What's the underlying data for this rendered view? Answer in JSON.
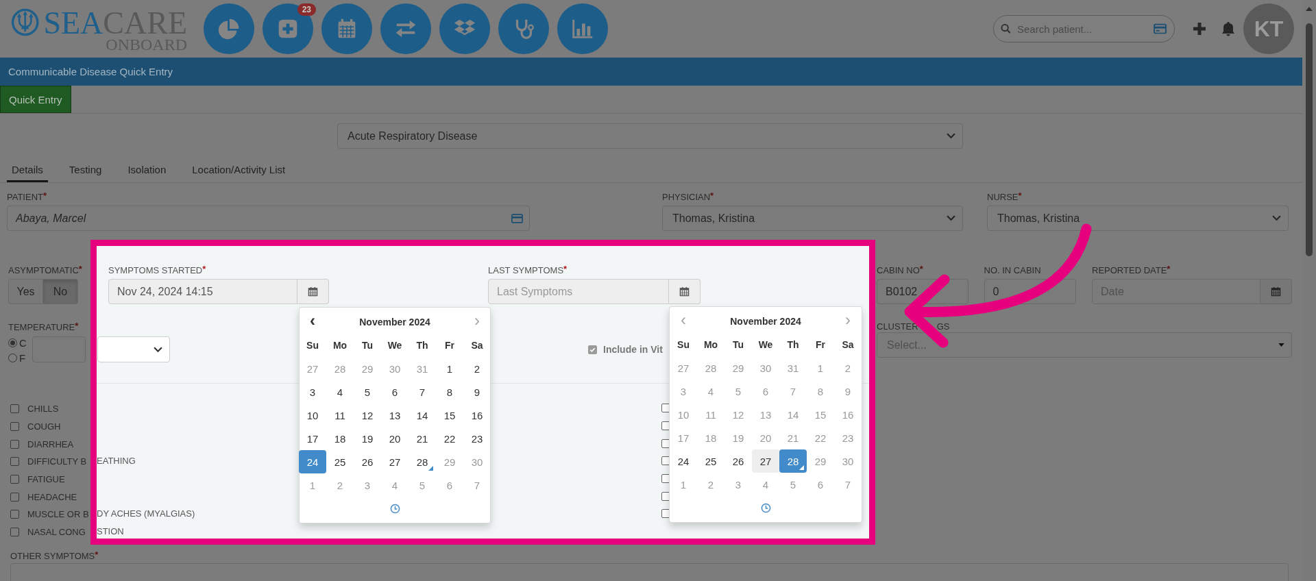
{
  "header": {
    "logo": {
      "name_a": "SEA",
      "name_b": "CARE",
      "tagline": "ONBOARD"
    },
    "nav": [
      {
        "kind": "pie"
      },
      {
        "kind": "add",
        "badge": "23"
      },
      {
        "kind": "calendar"
      },
      {
        "kind": "transfer"
      },
      {
        "kind": "dropbox"
      },
      {
        "kind": "stethoscope"
      },
      {
        "kind": "bars"
      }
    ],
    "search": {
      "placeholder": "Search patient..."
    },
    "avatar": "KT"
  },
  "title_bar": "Communicable Disease Quick Entry",
  "page_tabs": [
    {
      "label": "Quick Entry",
      "selected": true
    }
  ],
  "disease_select": {
    "value": "Acute Respiratory Disease"
  },
  "tabs": [
    {
      "label": "Details",
      "selected": true
    },
    {
      "label": "Testing",
      "selected": false
    },
    {
      "label": "Isolation",
      "selected": false
    },
    {
      "label": "Location/Activity List",
      "selected": false
    }
  ],
  "patient": {
    "label": "PATIENT",
    "required": "*",
    "value": "Abaya, Marcel"
  },
  "physician": {
    "label": "PHYSICIAN",
    "required": "*",
    "value": "Thomas, Kristina"
  },
  "nurse": {
    "label": "NURSE",
    "required": "*",
    "value": "Thomas, Kristina"
  },
  "asymptomatic": {
    "label": "ASYMPTOMATIC",
    "required": "*",
    "options": [
      {
        "label": "Yes",
        "selected": false
      },
      {
        "label": "No",
        "selected": true
      }
    ]
  },
  "temperature": {
    "label": "TEMPERATURE",
    "required": "*",
    "units": [
      {
        "label": "C",
        "selected": true
      },
      {
        "label": "F",
        "selected": false
      }
    ]
  },
  "symptoms_started": {
    "label": "SYMPTOMS STARTED",
    "required": "*",
    "value": "Nov 24, 2024 14:15"
  },
  "last_symptoms": {
    "label": "LAST SYMPTOMS",
    "required": "*",
    "placeholder": "Last Symptoms"
  },
  "include_in_vitals": {
    "label": "Include in Vit",
    "checked": true
  },
  "calendars": [
    {
      "title": "November 2024",
      "prev": {
        "label": "‹",
        "disabled": false
      },
      "next": {
        "label": "›",
        "disabled": true
      },
      "weekdays": [
        "Su",
        "Mo",
        "Tu",
        "We",
        "Th",
        "Fr",
        "Sa"
      ],
      "days": [
        {
          "label": "27",
          "muted": true,
          "selected": false,
          "today": false,
          "highlighted": false
        },
        {
          "label": "28",
          "muted": true,
          "selected": false,
          "today": false,
          "highlighted": false
        },
        {
          "label": "29",
          "muted": true,
          "selected": false,
          "today": false,
          "highlighted": false
        },
        {
          "label": "30",
          "muted": true,
          "selected": false,
          "today": false,
          "highlighted": false
        },
        {
          "label": "31",
          "muted": true,
          "selected": false,
          "today": false,
          "highlighted": false
        },
        {
          "label": "1",
          "muted": false,
          "selected": false,
          "today": false,
          "highlighted": false
        },
        {
          "label": "2",
          "muted": false,
          "selected": false,
          "today": false,
          "highlighted": false
        },
        {
          "label": "3",
          "muted": false,
          "selected": false,
          "today": false,
          "highlighted": false
        },
        {
          "label": "4",
          "muted": false,
          "selected": false,
          "today": false,
          "highlighted": false
        },
        {
          "label": "5",
          "muted": false,
          "selected": false,
          "today": false,
          "highlighted": false
        },
        {
          "label": "6",
          "muted": false,
          "selected": false,
          "today": false,
          "highlighted": false
        },
        {
          "label": "7",
          "muted": false,
          "selected": false,
          "today": false,
          "highlighted": false
        },
        {
          "label": "8",
          "muted": false,
          "selected": false,
          "today": false,
          "highlighted": false
        },
        {
          "label": "9",
          "muted": false,
          "selected": false,
          "today": false,
          "highlighted": false
        },
        {
          "label": "10",
          "muted": false,
          "selected": false,
          "today": false,
          "highlighted": false
        },
        {
          "label": "11",
          "muted": false,
          "selected": false,
          "today": false,
          "highlighted": false
        },
        {
          "label": "12",
          "muted": false,
          "selected": false,
          "today": false,
          "highlighted": false
        },
        {
          "label": "13",
          "muted": false,
          "selected": false,
          "today": false,
          "highlighted": false
        },
        {
          "label": "14",
          "muted": false,
          "selected": false,
          "today": false,
          "highlighted": false
        },
        {
          "label": "15",
          "muted": false,
          "selected": false,
          "today": false,
          "highlighted": false
        },
        {
          "label": "16",
          "muted": false,
          "selected": false,
          "today": false,
          "highlighted": false
        },
        {
          "label": "17",
          "muted": false,
          "selected": false,
          "today": false,
          "highlighted": false
        },
        {
          "label": "18",
          "muted": false,
          "selected": false,
          "today": false,
          "highlighted": false
        },
        {
          "label": "19",
          "muted": false,
          "selected": false,
          "today": false,
          "highlighted": false
        },
        {
          "label": "20",
          "muted": false,
          "selected": false,
          "today": false,
          "highlighted": false
        },
        {
          "label": "21",
          "muted": false,
          "selected": false,
          "today": false,
          "highlighted": false
        },
        {
          "label": "22",
          "muted": false,
          "selected": false,
          "today": false,
          "highlighted": false
        },
        {
          "label": "23",
          "muted": false,
          "selected": false,
          "today": false,
          "highlighted": false
        },
        {
          "label": "24",
          "muted": false,
          "selected": true,
          "today": false,
          "highlighted": false
        },
        {
          "label": "25",
          "muted": false,
          "selected": false,
          "today": false,
          "highlighted": false
        },
        {
          "label": "26",
          "muted": false,
          "selected": false,
          "today": false,
          "highlighted": false
        },
        {
          "label": "27",
          "muted": false,
          "selected": false,
          "today": false,
          "highlighted": false
        },
        {
          "label": "28",
          "muted": false,
          "selected": false,
          "today": true,
          "highlighted": false
        },
        {
          "label": "29",
          "muted": true,
          "selected": false,
          "today": false,
          "highlighted": false
        },
        {
          "label": "30",
          "muted": true,
          "selected": false,
          "today": false,
          "highlighted": false
        },
        {
          "label": "1",
          "muted": true,
          "selected": false,
          "today": false,
          "highlighted": false
        },
        {
          "label": "2",
          "muted": true,
          "selected": false,
          "today": false,
          "highlighted": false
        },
        {
          "label": "3",
          "muted": true,
          "selected": false,
          "today": false,
          "highlighted": false
        },
        {
          "label": "4",
          "muted": true,
          "selected": false,
          "today": false,
          "highlighted": false
        },
        {
          "label": "5",
          "muted": true,
          "selected": false,
          "today": false,
          "highlighted": false
        },
        {
          "label": "6",
          "muted": true,
          "selected": false,
          "today": false,
          "highlighted": false
        },
        {
          "label": "7",
          "muted": true,
          "selected": false,
          "today": false,
          "highlighted": false
        }
      ]
    },
    {
      "title": "November 2024",
      "prev": {
        "label": "‹",
        "disabled": true
      },
      "next": {
        "label": "›",
        "disabled": true
      },
      "weekdays": [
        "Su",
        "Mo",
        "Tu",
        "We",
        "Th",
        "Fr",
        "Sa"
      ],
      "days": [
        {
          "label": "27",
          "muted": true,
          "selected": false,
          "today": false,
          "highlighted": false
        },
        {
          "label": "28",
          "muted": true,
          "selected": false,
          "today": false,
          "highlighted": false
        },
        {
          "label": "29",
          "muted": true,
          "selected": false,
          "today": false,
          "highlighted": false
        },
        {
          "label": "30",
          "muted": true,
          "selected": false,
          "today": false,
          "highlighted": false
        },
        {
          "label": "31",
          "muted": true,
          "selected": false,
          "today": false,
          "highlighted": false
        },
        {
          "label": "1",
          "muted": true,
          "selected": false,
          "today": false,
          "highlighted": false
        },
        {
          "label": "2",
          "muted": true,
          "selected": false,
          "today": false,
          "highlighted": false
        },
        {
          "label": "3",
          "muted": true,
          "selected": false,
          "today": false,
          "highlighted": false
        },
        {
          "label": "4",
          "muted": true,
          "selected": false,
          "today": false,
          "highlighted": false
        },
        {
          "label": "5",
          "muted": true,
          "selected": false,
          "today": false,
          "highlighted": false
        },
        {
          "label": "6",
          "muted": true,
          "selected": false,
          "today": false,
          "highlighted": false
        },
        {
          "label": "7",
          "muted": true,
          "selected": false,
          "today": false,
          "highlighted": false
        },
        {
          "label": "8",
          "muted": true,
          "selected": false,
          "today": false,
          "highlighted": false
        },
        {
          "label": "9",
          "muted": true,
          "selected": false,
          "today": false,
          "highlighted": false
        },
        {
          "label": "10",
          "muted": true,
          "selected": false,
          "today": false,
          "highlighted": false
        },
        {
          "label": "11",
          "muted": true,
          "selected": false,
          "today": false,
          "highlighted": false
        },
        {
          "label": "12",
          "muted": true,
          "selected": false,
          "today": false,
          "highlighted": false
        },
        {
          "label": "13",
          "muted": true,
          "selected": false,
          "today": false,
          "highlighted": false
        },
        {
          "label": "14",
          "muted": true,
          "selected": false,
          "today": false,
          "highlighted": false
        },
        {
          "label": "15",
          "muted": true,
          "selected": false,
          "today": false,
          "highlighted": false
        },
        {
          "label": "16",
          "muted": true,
          "selected": false,
          "today": false,
          "highlighted": false
        },
        {
          "label": "17",
          "muted": true,
          "selected": false,
          "today": false,
          "highlighted": false
        },
        {
          "label": "18",
          "muted": true,
          "selected": false,
          "today": false,
          "highlighted": false
        },
        {
          "label": "19",
          "muted": true,
          "selected": false,
          "today": false,
          "highlighted": false
        },
        {
          "label": "20",
          "muted": true,
          "selected": false,
          "today": false,
          "highlighted": false
        },
        {
          "label": "21",
          "muted": true,
          "selected": false,
          "today": false,
          "highlighted": false
        },
        {
          "label": "22",
          "muted": true,
          "selected": false,
          "today": false,
          "highlighted": false
        },
        {
          "label": "23",
          "muted": true,
          "selected": false,
          "today": false,
          "highlighted": false
        },
        {
          "label": "24",
          "muted": false,
          "selected": false,
          "today": false,
          "highlighted": false
        },
        {
          "label": "25",
          "muted": false,
          "selected": false,
          "today": false,
          "highlighted": false
        },
        {
          "label": "26",
          "muted": false,
          "selected": false,
          "today": false,
          "highlighted": false
        },
        {
          "label": "27",
          "muted": false,
          "selected": false,
          "today": false,
          "highlighted": true
        },
        {
          "label": "28",
          "muted": false,
          "selected": true,
          "today": true,
          "highlighted": false
        },
        {
          "label": "29",
          "muted": true,
          "selected": false,
          "today": false,
          "highlighted": false
        },
        {
          "label": "30",
          "muted": true,
          "selected": false,
          "today": false,
          "highlighted": false
        },
        {
          "label": "1",
          "muted": true,
          "selected": false,
          "today": false,
          "highlighted": false
        },
        {
          "label": "2",
          "muted": true,
          "selected": false,
          "today": false,
          "highlighted": false
        },
        {
          "label": "3",
          "muted": true,
          "selected": false,
          "today": false,
          "highlighted": false
        },
        {
          "label": "4",
          "muted": true,
          "selected": false,
          "today": false,
          "highlighted": false
        },
        {
          "label": "5",
          "muted": true,
          "selected": false,
          "today": false,
          "highlighted": false
        },
        {
          "label": "6",
          "muted": true,
          "selected": false,
          "today": false,
          "highlighted": false
        },
        {
          "label": "7",
          "muted": true,
          "selected": false,
          "today": false,
          "highlighted": false
        }
      ]
    }
  ],
  "cabin_no": {
    "label": "CABIN NO",
    "required": "*",
    "value": "B0102"
  },
  "no_in_cabin": {
    "label": "NO. IN CABIN",
    "value": "0"
  },
  "reported_date": {
    "label": "REPORTED DATE",
    "required": "*",
    "placeholder": "Date"
  },
  "cluster_tags": {
    "label_parts": [
      "CLUSTER",
      "GS"
    ],
    "placeholder": "Select..."
  },
  "symptoms": [
    {
      "label": "CHILLS",
      "checked": false
    },
    {
      "label": "COUGH",
      "checked": false
    },
    {
      "label": "DIARRHEA",
      "checked": false
    },
    {
      "label": "DIFFICULTY B",
      "label_tail": "EATHING",
      "checked": false
    },
    {
      "label": "FATIGUE",
      "checked": false
    },
    {
      "label": "HEADACHE",
      "checked": false
    },
    {
      "label": "MUSCLE OR B",
      "label_tail": "DY ACHES (MYALGIAS)",
      "checked": false
    },
    {
      "label": "NASAL CONG",
      "label_tail": "STION",
      "checked": false
    }
  ],
  "symptoms_column_2": [
    {
      "checked": false
    },
    {
      "checked": false
    },
    {
      "checked": false
    },
    {
      "checked": false
    },
    {
      "checked": false
    },
    {
      "checked": false
    },
    {
      "checked": false
    }
  ],
  "other_symptoms": {
    "label": "OTHER SYMPTOMS",
    "required": "*"
  }
}
